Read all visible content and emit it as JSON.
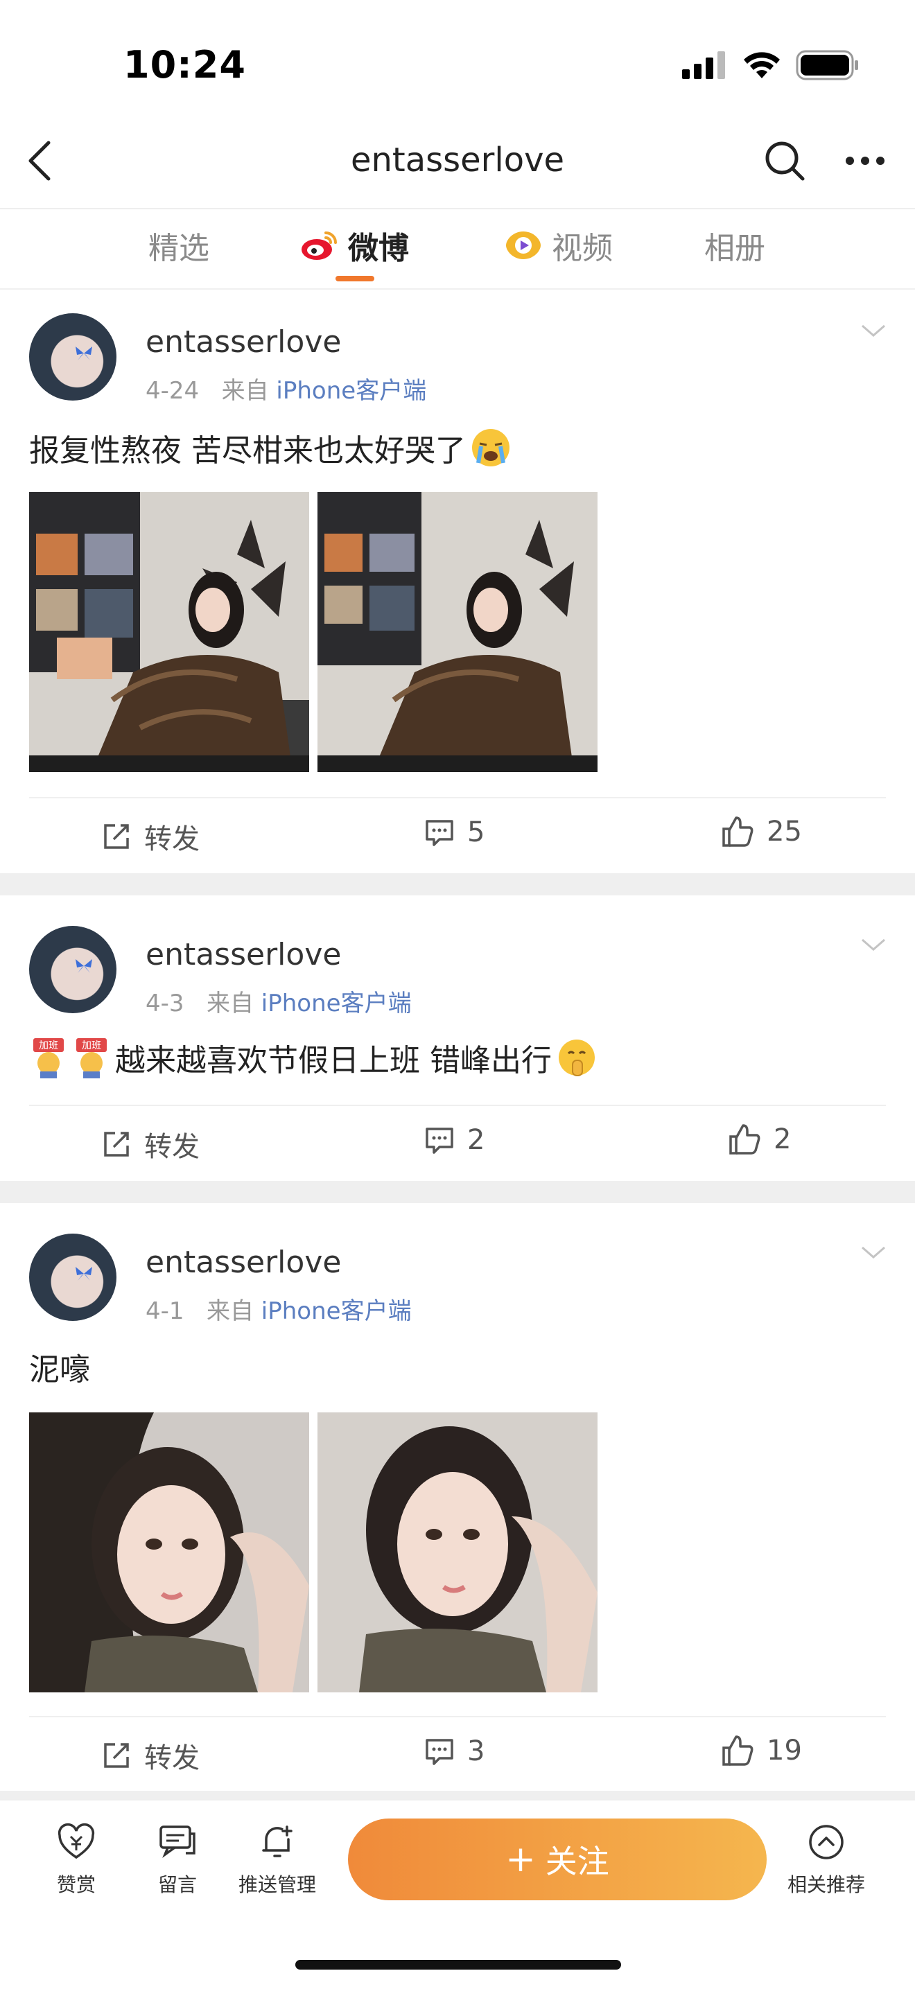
{
  "status_bar": {
    "time": "10:24"
  },
  "nav": {
    "title": "entasserlove"
  },
  "tabs": [
    {
      "label": "精选",
      "active": false
    },
    {
      "label": "微博",
      "active": true
    },
    {
      "label": "视频",
      "active": false
    },
    {
      "label": "相册",
      "active": false
    }
  ],
  "posts": [
    {
      "username": "entasserlove",
      "date": "4-24",
      "source_prefix": "来自",
      "source": "iPhone客户端",
      "text": "报复性熬夜 苦尽柑来也太好哭了",
      "trailing_emoji": "crying-emoji",
      "repost_label": "转发",
      "comments": "5",
      "likes": "25"
    },
    {
      "username": "entasserlove",
      "date": "4-3",
      "source_prefix": "来自",
      "source": "iPhone客户端",
      "text": "越来越喜欢节假日上班 错峰出行",
      "sticker_text": "加班",
      "trailing_emoji": "shush-emoji",
      "repost_label": "转发",
      "comments": "2",
      "likes": "2"
    },
    {
      "username": "entasserlove",
      "date": "4-1",
      "source_prefix": "来自",
      "source": "iPhone客户端",
      "text": "泥嚎",
      "repost_label": "转发",
      "comments": "3",
      "likes": "19"
    }
  ],
  "bottom_bar": {
    "reward": "赞赏",
    "message": "留言",
    "push": "推送管理",
    "follow": "关注",
    "related": "相关推荐"
  },
  "colors": {
    "accent": "#f0772c",
    "link": "#5b7ec0",
    "follow_start": "#f08a3a",
    "follow_end": "#f5b64e"
  }
}
